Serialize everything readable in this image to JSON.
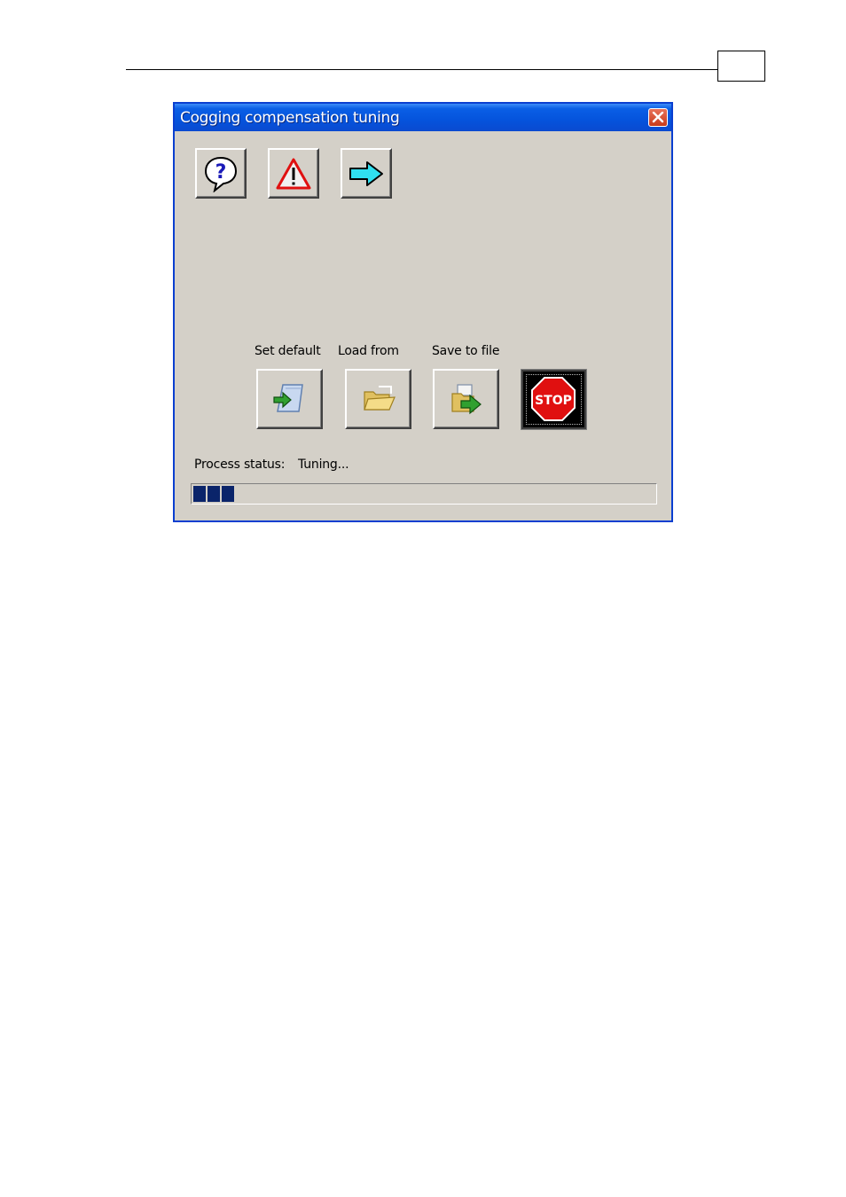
{
  "window": {
    "title": "Cogging compensation tuning",
    "close_icon": "close-icon"
  },
  "toolbar": {
    "help_icon": "question-balloon-icon",
    "warning_icon": "warning-triangle-icon",
    "next_icon": "right-arrow-icon"
  },
  "actions": {
    "set_default_label": "Set default",
    "load_from_label": "Load from",
    "save_to_file_label": "Save to file",
    "set_default_icon": "document-arrow-icon",
    "load_from_icon": "open-folder-icon",
    "save_to_file_icon": "save-folder-arrow-icon",
    "stop_icon": "stop-sign-icon",
    "stop_text": "STOP"
  },
  "status": {
    "label": "Process status:",
    "value": "Tuning..."
  },
  "colors": {
    "titlebar": "#0553dc",
    "face": "#d4d0c8",
    "progress": "#0a246a",
    "stop": "#e01010"
  }
}
